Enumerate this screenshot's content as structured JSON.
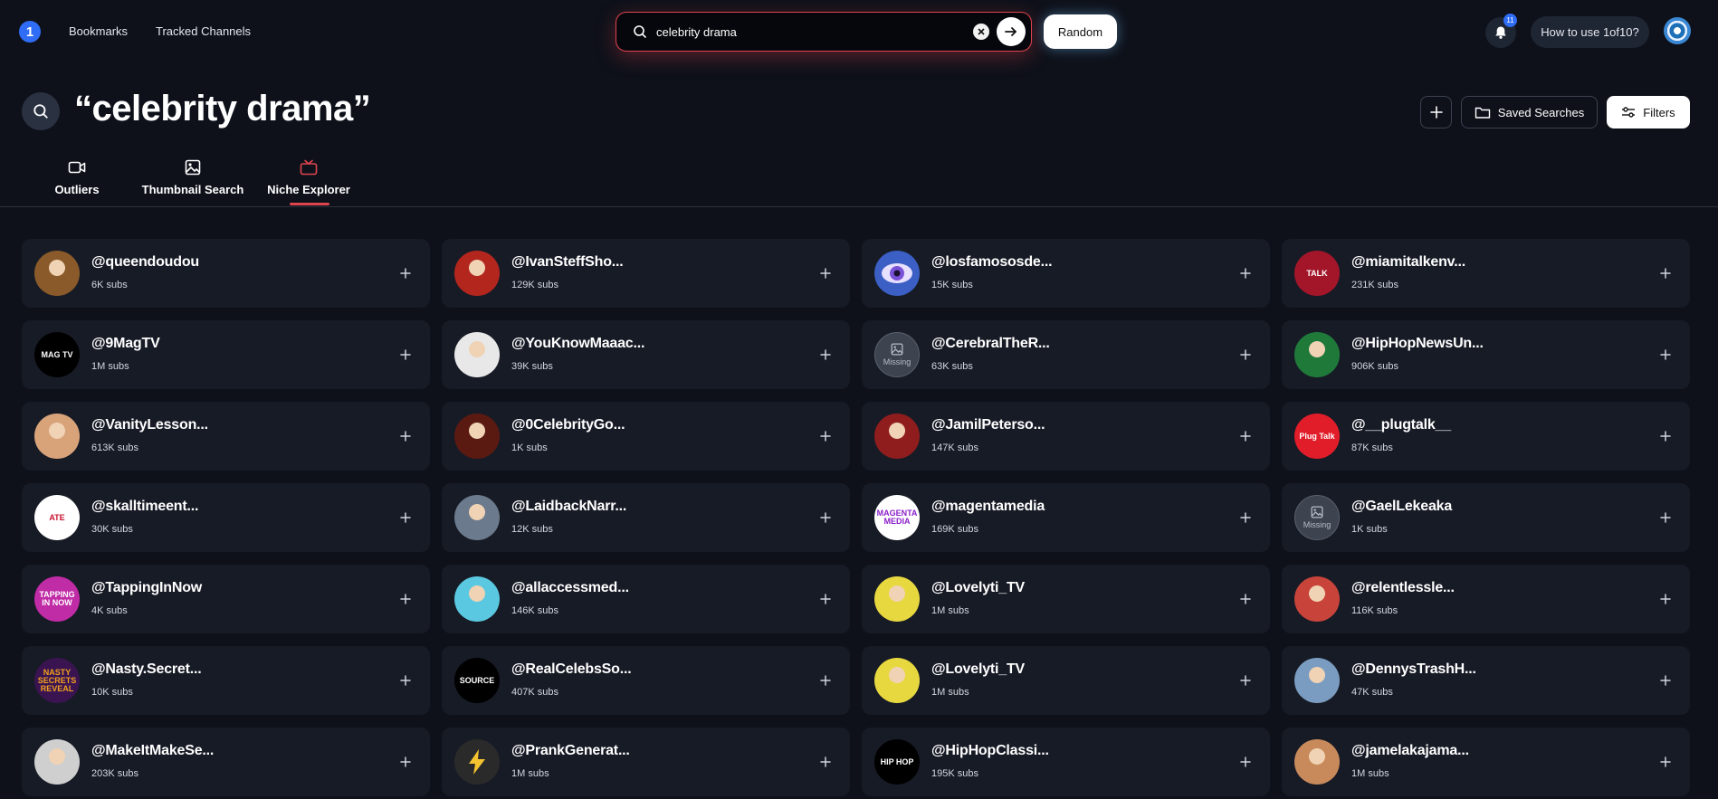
{
  "app": {
    "logo_text": "1"
  },
  "nav": {
    "bookmarks": "Bookmarks",
    "tracked_channels": "Tracked Channels"
  },
  "search": {
    "value": "celebrity drama",
    "placeholder": ""
  },
  "buttons": {
    "random": "Random",
    "how_to": "How to use 1of10?",
    "saved_searches": "Saved Searches",
    "filters": "Filters"
  },
  "notifications": {
    "count": "11"
  },
  "page": {
    "title": "“celebrity drama”"
  },
  "tabs": [
    {
      "label": "Outliers",
      "icon": "video-icon"
    },
    {
      "label": "Thumbnail Search",
      "icon": "image-icon"
    },
    {
      "label": "Niche Explorer",
      "icon": "tv-icon",
      "active": true
    }
  ],
  "colors": {
    "accent": "#e0444f",
    "brand": "#2f6df6",
    "background": "#0e111a",
    "card": "#171b26"
  },
  "channels": [
    {
      "handle": "@queendoudou",
      "subs": "6K subs",
      "avatar": "photo",
      "color": "#8a5a2a"
    },
    {
      "handle": "@IvanSteffSho...",
      "subs": "129K subs",
      "avatar": "photo",
      "color": "#b3261e"
    },
    {
      "handle": "@losfamososde...",
      "subs": "15K subs",
      "avatar": "eye",
      "color": "#3b5fc4"
    },
    {
      "handle": "@miamitalkenv...",
      "subs": "231K subs",
      "avatar": "logo",
      "color": "#a3162a",
      "logo_text": "TALK"
    },
    {
      "handle": "@9MagTV",
      "subs": "1M subs",
      "avatar": "logo",
      "color": "#000000",
      "logo_text": "MAG TV"
    },
    {
      "handle": "@YouKnowMaaac...",
      "subs": "39K subs",
      "avatar": "photo",
      "color": "#e8e8e8"
    },
    {
      "handle": "@CerebralTheR...",
      "subs": "63K subs",
      "avatar": "missing",
      "missing_label": "Missing"
    },
    {
      "handle": "@HipHopNewsUn...",
      "subs": "906K subs",
      "avatar": "photo",
      "color": "#1f7a3a"
    },
    {
      "handle": "@VanityLesson...",
      "subs": "613K subs",
      "avatar": "photo",
      "color": "#d9a37a"
    },
    {
      "handle": "@0CelebrityGo...",
      "subs": "1K subs",
      "avatar": "photo",
      "color": "#5a1a12"
    },
    {
      "handle": "@JamilPeterso...",
      "subs": "147K subs",
      "avatar": "photo",
      "color": "#8f1d1d"
    },
    {
      "handle": "@__plugtalk__",
      "subs": "87K subs",
      "avatar": "logo",
      "color": "#e11d2a",
      "logo_text": "Plug Talk"
    },
    {
      "handle": "@skalltimeent...",
      "subs": "30K subs",
      "avatar": "logo",
      "color": "#ffffff",
      "logo_text": "ATE",
      "logo_color": "#c8102e"
    },
    {
      "handle": "@LaidbackNarr...",
      "subs": "12K subs",
      "avatar": "photo",
      "color": "#6b7a8c"
    },
    {
      "handle": "@magentamedia",
      "subs": "169K subs",
      "avatar": "logo",
      "color": "#ffffff",
      "logo_text": "MAGENTA MEDIA",
      "logo_color": "#8a1fc9"
    },
    {
      "handle": "@GaelLekeaka",
      "subs": "1K subs",
      "avatar": "missing",
      "missing_label": "Missing"
    },
    {
      "handle": "@TappingInNow",
      "subs": "4K subs",
      "avatar": "logo",
      "color": "#c02ba6",
      "logo_text": "TAPPING IN NOW"
    },
    {
      "handle": "@allaccessmed...",
      "subs": "146K subs",
      "avatar": "photo",
      "color": "#5ac8e0"
    },
    {
      "handle": "@Lovelyti_TV",
      "subs": "1M subs",
      "avatar": "photo",
      "color": "#e8d840"
    },
    {
      "handle": "@relentlessle...",
      "subs": "116K subs",
      "avatar": "photo",
      "color": "#c8443a"
    },
    {
      "handle": "@Nasty.Secret...",
      "subs": "10K subs",
      "avatar": "logo",
      "color": "#3a1450",
      "logo_text": "NASTY SECRETS REVEAL",
      "logo_color": "#f0a020"
    },
    {
      "handle": "@RealCelebsSo...",
      "subs": "407K subs",
      "avatar": "logo",
      "color": "#000000",
      "logo_text": "SOURCE"
    },
    {
      "handle": "@Lovelyti_TV",
      "subs": "1M subs",
      "avatar": "photo",
      "color": "#e8d840"
    },
    {
      "handle": "@DennysTrashH...",
      "subs": "47K subs",
      "avatar": "photo",
      "color": "#7a9cc0"
    },
    {
      "handle": "@MakeItMakeSe...",
      "subs": "203K subs",
      "avatar": "photo",
      "color": "#cfcfcf"
    },
    {
      "handle": "@PrankGenerat...",
      "subs": "1M subs",
      "avatar": "bolt",
      "color": "#2a2a2a"
    },
    {
      "handle": "@HipHopClassi...",
      "subs": "195K subs",
      "avatar": "logo",
      "color": "#000000",
      "logo_text": "HIP HOP"
    },
    {
      "handle": "@jamelakajama...",
      "subs": "1M subs",
      "avatar": "photo",
      "color": "#c88a5a"
    }
  ]
}
